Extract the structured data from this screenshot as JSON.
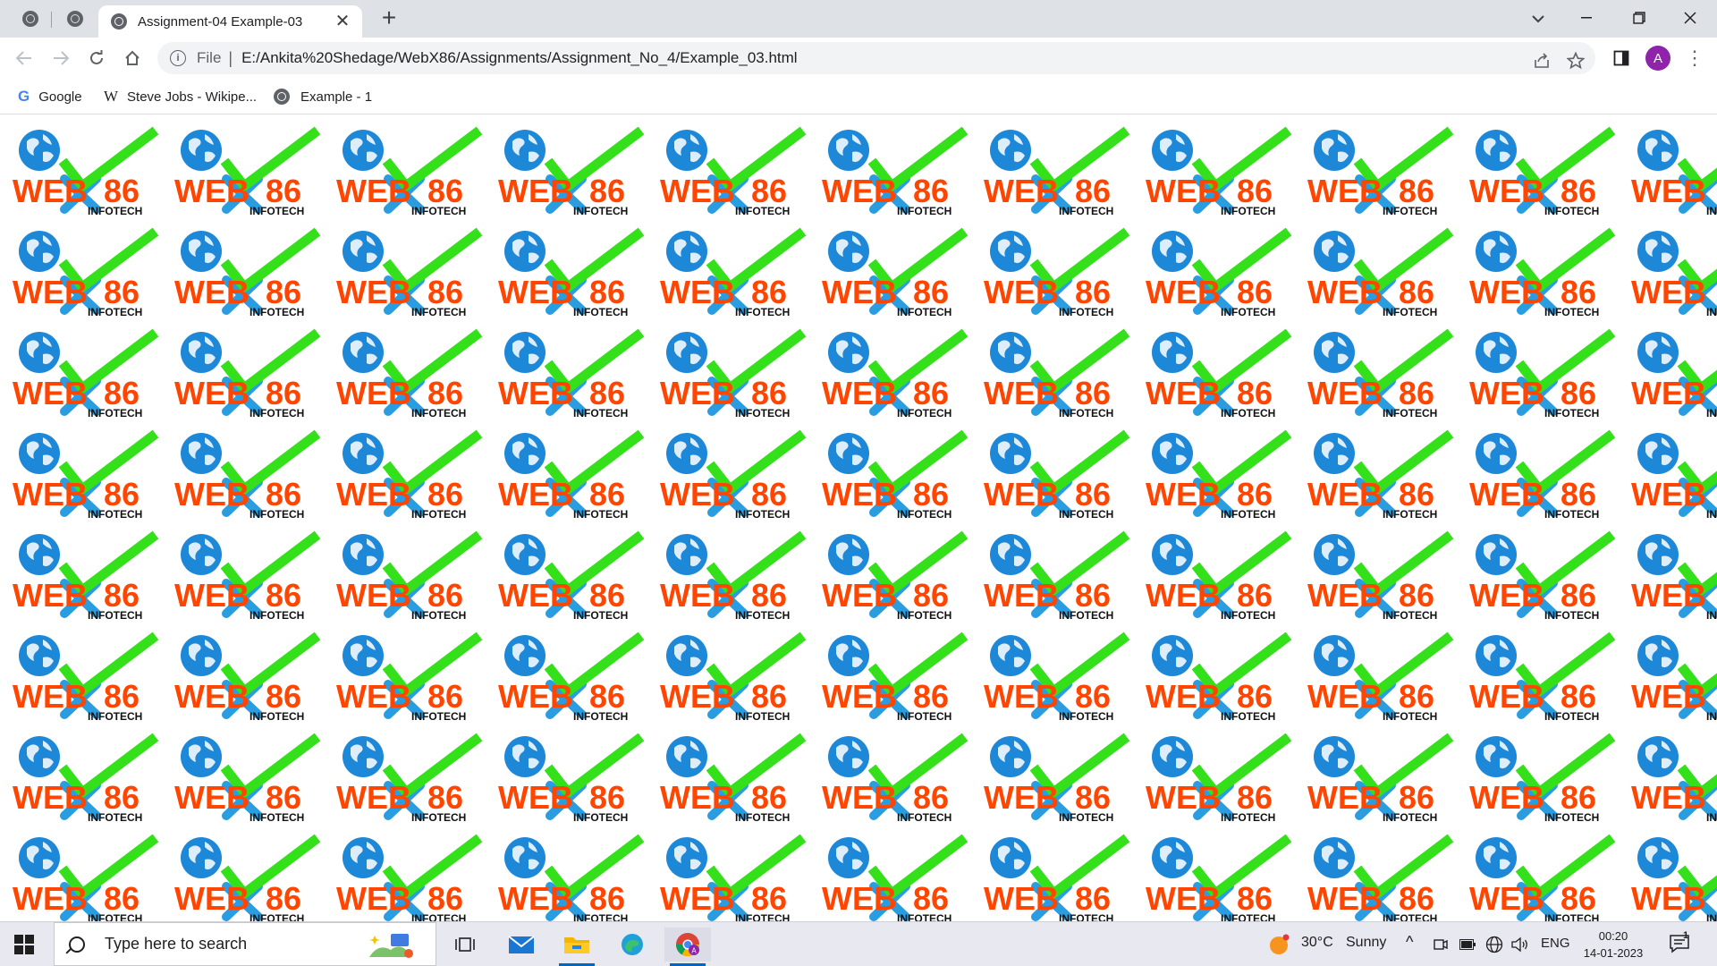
{
  "browser": {
    "tabs": [
      {
        "title": "Assignment-04 Example-03",
        "active": true
      }
    ],
    "new_tab_symbol": "+",
    "close_symbol": "✕",
    "address_bar": {
      "scheme_label": "File",
      "url": "E:/Ankita%20Shedage/WebX86/Assignments/Assignment_No_4/Example_03.html"
    },
    "profile_initial": "A",
    "bookmarks": [
      {
        "label": "Google",
        "icon": "google-icon"
      },
      {
        "label": "Steve Jobs - Wikipe...",
        "icon": "wikipedia-icon"
      },
      {
        "label": "Example - 1",
        "icon": "globe-icon"
      }
    ]
  },
  "page": {
    "logo": {
      "wordmark_left": "WEB",
      "wordmark_right": "86",
      "tagline": "INFOTECH",
      "colors": {
        "text": "#ff4500",
        "check": "#33e01a",
        "globe": "#1e88d8",
        "x_blue": "#2a9de0"
      }
    },
    "grid": {
      "rows": 8,
      "columns": 11
    }
  },
  "taskbar": {
    "search_placeholder": "Type here to search",
    "weather": {
      "temp": "30°C",
      "condition": "Sunny"
    },
    "language": "ENG",
    "time": "00:20",
    "date": "14-01-2023",
    "notification_count": "1"
  }
}
